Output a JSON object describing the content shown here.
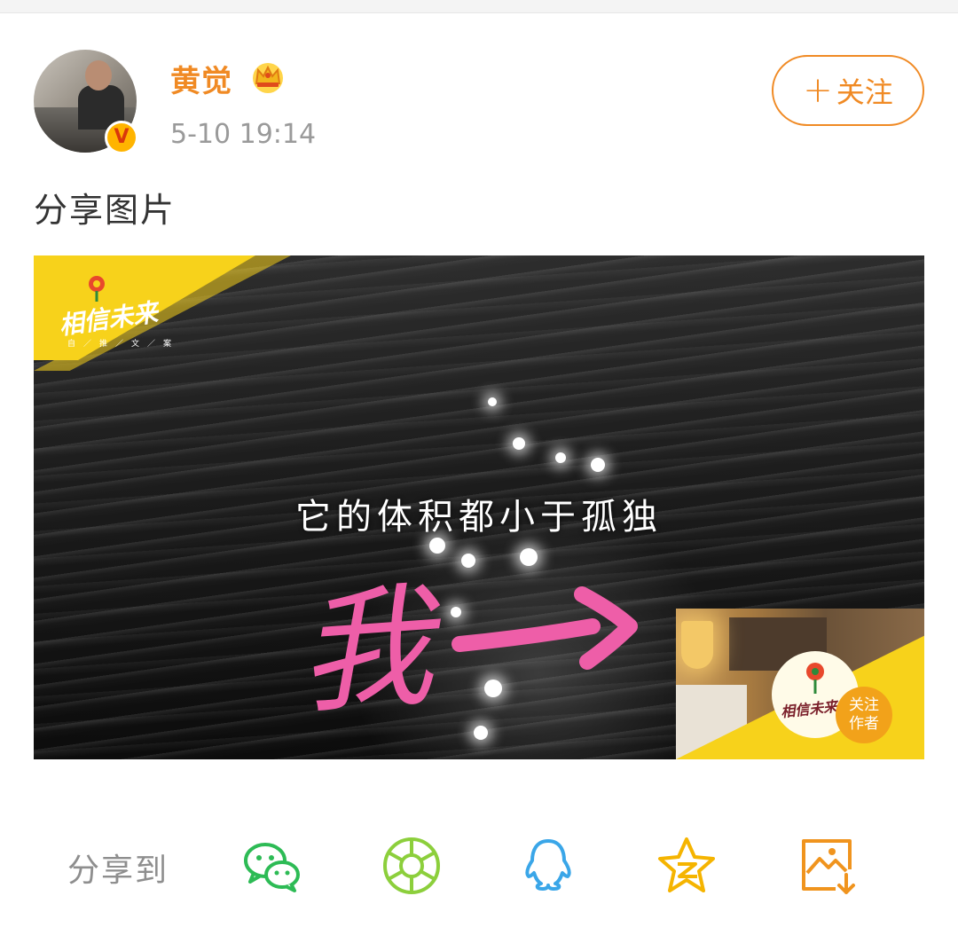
{
  "post": {
    "username": "黄觉",
    "timestamp": "5-10 19:14",
    "follow_label": "关注",
    "follow_plus": "+",
    "text": "分享图片",
    "verified_badge": "V",
    "membership_icon": "crown-icon"
  },
  "image": {
    "subtitle": "它的体积都小于孤独",
    "handwriting": "我",
    "logo_text": "相信未来",
    "logo_subtext": "自／推／文／案",
    "pip_logo_text": "相信未来",
    "follow_author_line1": "关注",
    "follow_author_line2": "作者"
  },
  "share": {
    "label": "分享到",
    "targets": [
      {
        "name": "wechat",
        "icon": "wechat-icon",
        "color": "#2dbb55"
      },
      {
        "name": "moments",
        "icon": "moments-icon",
        "color": "#8ccf3c"
      },
      {
        "name": "qq",
        "icon": "qq-icon",
        "color": "#3aa6e8"
      },
      {
        "name": "qzone",
        "icon": "qzone-icon",
        "color": "#f5b400"
      },
      {
        "name": "save-image",
        "icon": "save-image-icon",
        "color": "#f0941e"
      }
    ]
  },
  "colors": {
    "accent": "#f08a24",
    "meta_text": "#9a9a9a",
    "body_text": "#333333",
    "banner_yellow": "#f7d21b",
    "handwriting_pink": "#ee5ea8"
  }
}
